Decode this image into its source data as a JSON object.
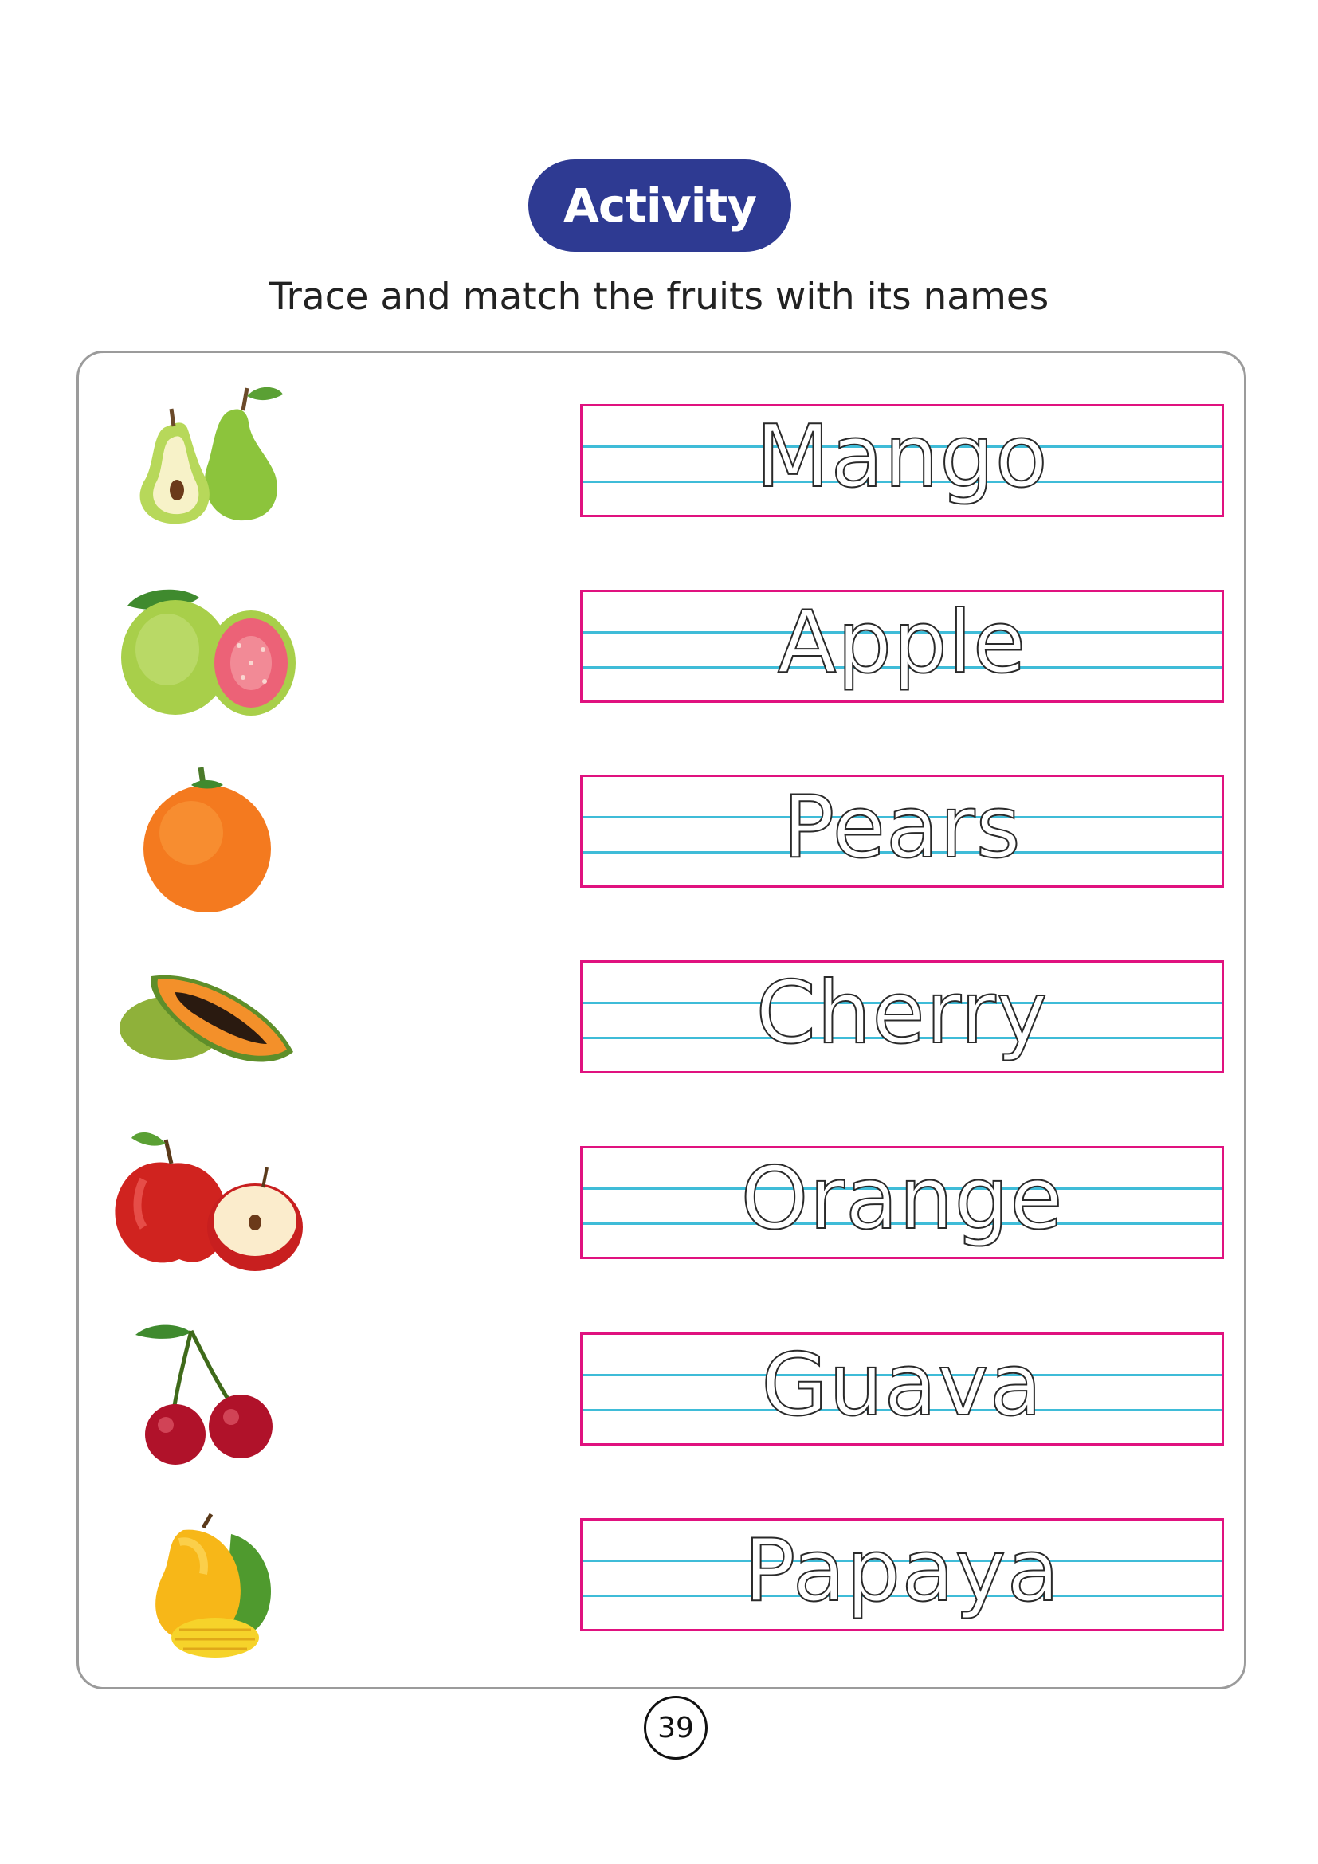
{
  "header": {
    "badge_label": "Activity",
    "instruction": "Trace and match the fruits with its names"
  },
  "rows": [
    {
      "fruit_icon": "pear-icon",
      "trace_word": "Mango"
    },
    {
      "fruit_icon": "guava-icon",
      "trace_word": "Apple"
    },
    {
      "fruit_icon": "orange-icon",
      "trace_word": "Pears"
    },
    {
      "fruit_icon": "papaya-icon",
      "trace_word": "Cherry"
    },
    {
      "fruit_icon": "apple-icon",
      "trace_word": "Orange"
    },
    {
      "fruit_icon": "cherry-icon",
      "trace_word": "Guava"
    },
    {
      "fruit_icon": "mango-icon",
      "trace_word": "Papaya"
    }
  ],
  "footer": {
    "page_number": "39"
  },
  "colors": {
    "badge": "#2e3a92",
    "trace_box_border": "#e0127f",
    "guide_lines": "#3fbcd8"
  }
}
